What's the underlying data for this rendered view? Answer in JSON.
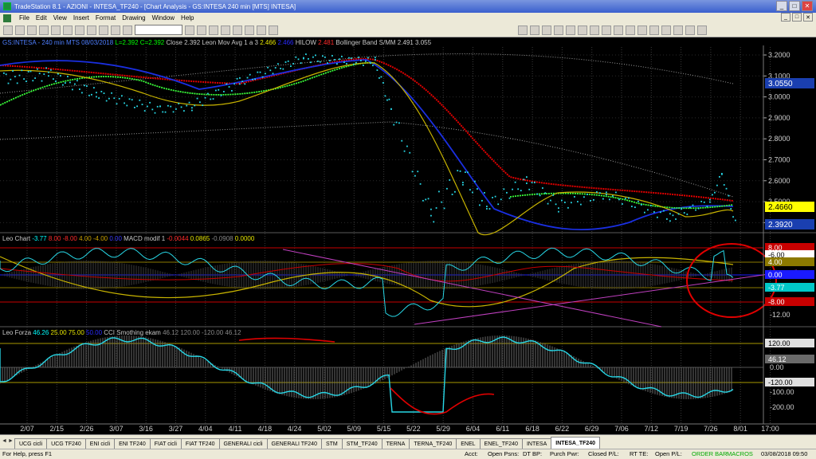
{
  "window": {
    "title": "TradeStation 8.1 - AZIONI - INTESA_TF240 - [Chart Analysis - GS:INTESA  240 min  [MTS] INTESA]",
    "controls": [
      "_",
      "□",
      "✕"
    ]
  },
  "menu": {
    "items": [
      "File",
      "Edit",
      "View",
      "Insert",
      "Format",
      "Drawing",
      "Window",
      "Help"
    ]
  },
  "price_pane": {
    "legend": [
      {
        "text": "GS:INTESA - 240 min   MTS  08/03/2018",
        "color": "#4f7fff"
      },
      {
        "text": "L=2.392",
        "color": "#00ff00"
      },
      {
        "text": "C=2.392",
        "color": "#00ff00"
      },
      {
        "text": "Close    2.392",
        "color": "#c8c8c8"
      },
      {
        "text": "Leon Mov Avg 1 a 3",
        "color": "#c8c8c8"
      },
      {
        "text": "2.466",
        "color": "#e6e600"
      },
      {
        "text": "2.466",
        "color": "#2a2aff"
      },
      {
        "text": "HILOW",
        "color": "#c8c8c8"
      },
      {
        "text": "2.481",
        "color": "#ff2a2a"
      },
      {
        "text": "Bollinger Band S/MM",
        "color": "#c8c8c8"
      },
      {
        "text": "2.491",
        "color": "#c8c8c8"
      },
      {
        "text": "3.055",
        "color": "#c8c8c8"
      }
    ],
    "yticks": [
      "3.2000",
      "3.1000",
      "3.0000",
      "2.9000",
      "2.8000",
      "2.7000",
      "2.6000",
      "2.5000",
      "2.4000"
    ],
    "badges": [
      {
        "text": "3.0550",
        "bg": "#1a3fb0",
        "fg": "#ffffff"
      },
      {
        "text": "2.4660",
        "bg": "#ffff00",
        "fg": "#000000"
      },
      {
        "text": "2.3920",
        "bg": "#1a3fb0",
        "fg": "#ffffff"
      }
    ]
  },
  "osc_pane": {
    "legend": [
      {
        "text": "Leo Chart",
        "color": "#c8c8c8"
      },
      {
        "text": "-3.77",
        "color": "#00ffff"
      },
      {
        "text": "8.00",
        "color": "#ff2a2a"
      },
      {
        "text": "-8.00",
        "color": "#ff2a2a"
      },
      {
        "text": "4.00",
        "color": "#c8a000"
      },
      {
        "text": "-4.00",
        "color": "#c8a000"
      },
      {
        "text": "0.00",
        "color": "#3a3aff"
      },
      {
        "text": "MACD modif 1",
        "color": "#c8c8c8"
      },
      {
        "text": "-0.0044",
        "color": "#ff2a2a"
      },
      {
        "text": "0.0865",
        "color": "#e6e600"
      },
      {
        "text": "-0.0908",
        "color": "#888888"
      },
      {
        "text": "0.0000",
        "color": "#e6e600"
      }
    ],
    "yticks": [
      "-12.00"
    ],
    "badges": [
      {
        "text": "8.00",
        "bg": "#c80000",
        "fg": "#ffffff"
      },
      {
        "text": "-6.00",
        "bg": "#ffffff",
        "fg": "#000000"
      },
      {
        "text": "4.00",
        "bg": "#8c7a00",
        "fg": "#ffffff"
      },
      {
        "text": "0.00",
        "bg": "#1a1aff",
        "fg": "#ffffff"
      },
      {
        "text": "-3.77",
        "bg": "#00c8c8",
        "fg": "#ffffff"
      },
      {
        "text": "-8.00",
        "bg": "#c80000",
        "fg": "#ffffff"
      }
    ]
  },
  "cci_pane": {
    "legend": [
      {
        "text": "Leo Forza",
        "color": "#c8c8c8"
      },
      {
        "text": "46.26",
        "color": "#00ffff"
      },
      {
        "text": "25.00",
        "color": "#e6e600"
      },
      {
        "text": "75.00",
        "color": "#e6e600"
      },
      {
        "text": "50.00",
        "color": "#2a2aff"
      },
      {
        "text": "CCI Smothing ekam",
        "color": "#c8c8c8"
      },
      {
        "text": "46.12",
        "color": "#888888"
      },
      {
        "text": "120.00",
        "color": "#888888"
      },
      {
        "text": "-120.00",
        "color": "#888888"
      },
      {
        "text": "46.12",
        "color": "#888888"
      }
    ],
    "yticks": [
      "0.00",
      "-100.00",
      "-200.00"
    ],
    "badges": [
      {
        "text": "120.00",
        "bg": "#e0e0e0",
        "fg": "#000000"
      },
      {
        "text": "46.12",
        "bg": "#6a6a6a",
        "fg": "#ffffff"
      },
      {
        "text": "-120.00",
        "bg": "#e0e0e0",
        "fg": "#000000"
      }
    ]
  },
  "x_axis": {
    "labels": [
      "2/07",
      "2/15",
      "2/26",
      "3/07",
      "3/16",
      "3/27",
      "4/04",
      "4/11",
      "4/18",
      "4/24",
      "5/02",
      "5/09",
      "5/15",
      "5/22",
      "5/29",
      "6/04",
      "6/11",
      "6/18",
      "6/22",
      "6/29",
      "7/06",
      "7/12",
      "7/19",
      "7/26",
      "8/01",
      "17:00"
    ]
  },
  "tabs": {
    "items": [
      "UCG cicli",
      "UCG TF240",
      "ENI cicli",
      "ENI TF240",
      "FIAT cicli",
      "FIAT TF240",
      "GENERALI cicli",
      "GENERALI TF240",
      "STM",
      "STM_TF240",
      "TERNA",
      "TERNA_TF240",
      "ENEL",
      "ENEL_TF240",
      "INTESA",
      "INTESA_TF240"
    ],
    "active_index": 15
  },
  "statusbar": {
    "help": "For Help, press F1",
    "acct": "Acct:",
    "open_psns": "Open Psns:",
    "dt_bp": "DT BP:",
    "purch_pwr": "Purch Pwr:",
    "closed_pl": "Closed P/L:",
    "rt_te": "RT TE:",
    "open_pl": "Open P/L:",
    "order_bar": "ORDER BAR",
    "macros": "MACROS",
    "datetime": "03/08/2018 09:50"
  },
  "colors": {
    "price_dots": "#27d7e6",
    "leon_avg_yellow": "#c8b400",
    "blue_avg": "#1a2fe0",
    "hilow_red": "#e00000",
    "green_avg": "#3aff3a",
    "bollinger_gray": "#9a9a9a",
    "trendline": "#c040c0",
    "highlight_circle": "#e00000"
  }
}
